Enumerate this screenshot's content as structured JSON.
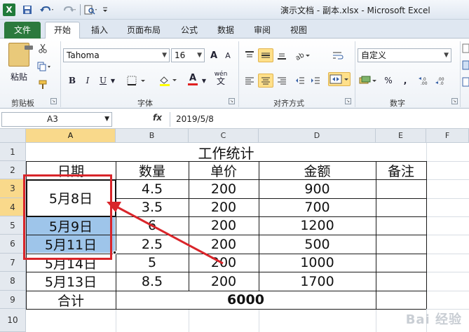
{
  "window": {
    "title": "演示文档 - 副本.xlsx - Microsoft Excel"
  },
  "tabs": [
    "文件",
    "开始",
    "插入",
    "页面布局",
    "公式",
    "数据",
    "审阅",
    "视图"
  ],
  "ribbon": {
    "paste_label": "粘贴",
    "font_name": "Tahoma",
    "font_size": "16",
    "number_format": "自定义",
    "groups": {
      "clipboard": "剪贴板",
      "font": "字体",
      "alignment": "对齐方式",
      "number": "数字"
    },
    "font_buttons": {
      "bold": "B",
      "italic": "I",
      "underline": "U",
      "grow": "A",
      "shrink": "A",
      "color": "A",
      "wen": "wén"
    },
    "number_buttons": {
      "percent": "%",
      "comma": ","
    }
  },
  "formula_bar": {
    "name_box": "A3",
    "fx": "fx",
    "content": "2019/5/8"
  },
  "columns": [
    "A",
    "B",
    "C",
    "D",
    "E",
    "F"
  ],
  "rows": [
    "1",
    "2",
    "3",
    "4",
    "5",
    "6",
    "7",
    "8",
    "9",
    "10"
  ],
  "sheet": {
    "title": "工作统计",
    "headers": [
      "日期",
      "数量",
      "单价",
      "金额",
      "备注"
    ],
    "merged_date": "5月8日",
    "data_rows": [
      {
        "date": "",
        "qty": "4.5",
        "price": "200",
        "amount": "900"
      },
      {
        "date": "",
        "qty": "3.5",
        "price": "200",
        "amount": "700"
      },
      {
        "date": "5月9日",
        "qty": "6",
        "price": "200",
        "amount": "1200"
      },
      {
        "date": "5月11日",
        "qty": "2.5",
        "price": "200",
        "amount": "500"
      },
      {
        "date": "5月14日",
        "qty": "5",
        "price": "200",
        "amount": "1000"
      },
      {
        "date": "5月13日",
        "qty": "8.5",
        "price": "200",
        "amount": "1700"
      }
    ],
    "total_label": "合计",
    "total_value": "6000"
  },
  "watermark": "Bai 经验",
  "colors": {
    "file_tab": "#2b7a3d",
    "selection": "#9ec5ea",
    "annotation": "#d9252a"
  }
}
